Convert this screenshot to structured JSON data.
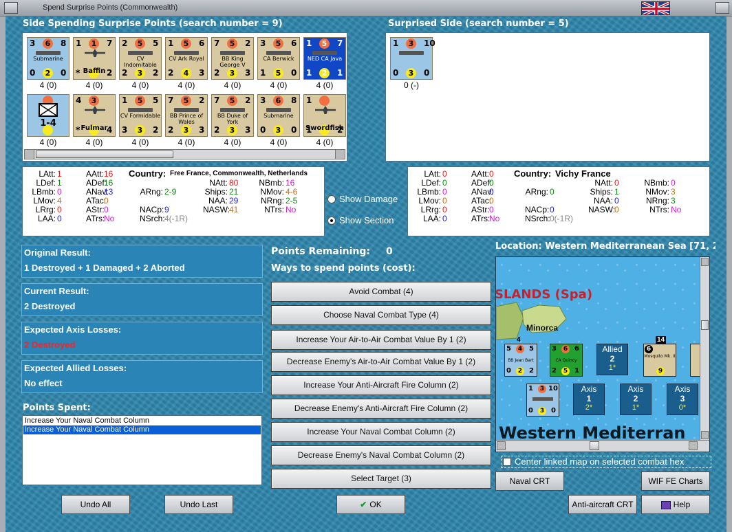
{
  "window": {
    "title": "Spend Surprise Points (Commonwealth)"
  },
  "headers": {
    "spending": "Side Spending Surprise Points (search number = 9)",
    "surprised": "Surprised Side (search number = 5)"
  },
  "spending_units": [
    {
      "name": "Submarine",
      "tl": "3",
      "tc": "6",
      "tr": "8",
      "bl": "0",
      "bc": "2",
      "br": "0",
      "count": "4 (0)",
      "kind": "ship",
      "style": "blue"
    },
    {
      "name": "Baffin",
      "tl": "1",
      "tc": "1",
      "tr": "7",
      "bl": "*",
      "bc": "",
      "br": "2",
      "count": "4 (0)",
      "kind": "plane",
      "style": "tan"
    },
    {
      "name": "CV Indomitable",
      "tl": "2",
      "tc": "5",
      "tr": "5",
      "bl": "2",
      "bc": "3",
      "br": "2",
      "count": "4 (0)",
      "kind": "ship",
      "style": "tan"
    },
    {
      "name": "CV Ark Royal",
      "tl": "1",
      "tc": "5",
      "tr": "6",
      "bl": "2",
      "bc": "4",
      "br": "3",
      "count": "4 (0)",
      "kind": "ship",
      "style": "tan"
    },
    {
      "name": "BB King George V",
      "tl": "7",
      "tc": "5",
      "tr": "2",
      "bl": "2",
      "bc": "3",
      "br": "3",
      "count": "4 (0)",
      "kind": "ship",
      "style": "tan"
    },
    {
      "name": "CA Berwick",
      "tl": "3",
      "tc": "5",
      "tr": "6",
      "bl": "1",
      "bc": "5",
      "br": "0",
      "count": "4 (0)",
      "kind": "ship",
      "style": "tan"
    },
    {
      "name": "NED CA Java",
      "tl": "1",
      "tc": "5",
      "tr": "7",
      "bl": "1",
      "bc": "2",
      "br": "1",
      "count": "4 (0)",
      "kind": "ship",
      "style": "dark"
    },
    {
      "name": "xx 1-4",
      "tl": "",
      "tc": "",
      "tr": "",
      "bl": "",
      "bc": "",
      "br": "",
      "count": "4 (0)",
      "kind": "div",
      "style": "blue"
    },
    {
      "name": "Fulmar",
      "tl": "4",
      "tc": "3",
      "tr": "",
      "bl": "*",
      "bc": "",
      "br": "4",
      "count": "4 (0)",
      "kind": "plane",
      "style": "tan"
    },
    {
      "name": "CV Formidable",
      "tl": "1",
      "tc": "5",
      "tr": "5",
      "bl": "3",
      "bc": "3",
      "br": "2",
      "count": "4 (0)",
      "kind": "ship",
      "style": "tan"
    },
    {
      "name": "BB Prince of Wales",
      "tl": "7",
      "tc": "5",
      "tr": "2",
      "bl": "2",
      "bc": "3",
      "br": "3",
      "count": "4 (0)",
      "kind": "ship",
      "style": "tan"
    },
    {
      "name": "BB Duke of York",
      "tl": "7",
      "tc": "5",
      "tr": "2",
      "bl": "2",
      "bc": "3",
      "br": "3",
      "count": "4 (0)",
      "kind": "ship",
      "style": "tan"
    },
    {
      "name": "Submarine",
      "tl": "3",
      "tc": "6",
      "tr": "8",
      "bl": "0",
      "bc": "3",
      "br": "0",
      "count": "4 (0)",
      "kind": "ship",
      "style": "tan"
    },
    {
      "name": "Swordfish",
      "tl": "1",
      "tc": "",
      "tr": "",
      "bl": "1",
      "bc": "",
      "br": "2",
      "count": "4 (0)",
      "kind": "plane",
      "style": "tan"
    }
  ],
  "surprised_units": [
    {
      "name": "",
      "tl": "1",
      "tc": "3",
      "tr": "10",
      "bl": "0",
      "bc": "3",
      "br": "0",
      "count": "0 (-)",
      "kind": "ship",
      "style": "blue"
    }
  ],
  "stats_left": {
    "c1": [
      [
        "LAtt:",
        "1"
      ],
      [
        "LDef:",
        "1"
      ],
      [
        "LBmb:",
        "0"
      ],
      [
        "LMov:",
        "4"
      ],
      [
        "LRrg:",
        "0"
      ],
      [
        "LAA:",
        "0"
      ]
    ],
    "c2": [
      [
        "AAtt:",
        "16"
      ],
      [
        "ADef:",
        "16"
      ],
      [
        "ANav:",
        "13"
      ],
      [
        "ATac:",
        "0"
      ],
      [
        "AStr:",
        "0"
      ],
      [
        "ATrs:",
        "No"
      ]
    ],
    "country_label": "Country:",
    "country": "Free France, Commonwealth, Netherlands",
    "c3": [
      [
        "",
        ""
      ],
      [
        "",
        ""
      ],
      [
        "ARng:",
        "2-9"
      ],
      [
        "",
        ""
      ],
      [
        "NACp:",
        "9"
      ],
      [
        "NSrch:",
        "4(-1R)"
      ]
    ],
    "c4": [
      [
        "NAtt:",
        "80"
      ],
      [
        "Ships:",
        "21"
      ],
      [
        "NAA:",
        "29"
      ],
      [
        "NASW:",
        "41"
      ]
    ],
    "c5": [
      [
        "NBmb:",
        "16"
      ],
      [
        "NMov:",
        "4-6"
      ],
      [
        "NRng:",
        "2-5"
      ],
      [
        "NTrs:",
        "No"
      ]
    ]
  },
  "stats_right": {
    "c1": [
      [
        "LAtt:",
        "0"
      ],
      [
        "LDef:",
        "0"
      ],
      [
        "LBmb:",
        "0"
      ],
      [
        "LMov:",
        "0"
      ],
      [
        "LRrg:",
        "0"
      ],
      [
        "LAA:",
        "0"
      ]
    ],
    "c2": [
      [
        "AAtt:",
        "0"
      ],
      [
        "ADef:",
        "0"
      ],
      [
        "ANav:",
        "0"
      ],
      [
        "ATac:",
        "0"
      ],
      [
        "AStr:",
        "0"
      ],
      [
        "ATrs:",
        "No"
      ]
    ],
    "country_label": "Country:",
    "country": "Vichy France",
    "c3": [
      [
        "",
        ""
      ],
      [
        "",
        ""
      ],
      [
        "ARng:",
        "0"
      ],
      [
        "",
        ""
      ],
      [
        "NACp:",
        "0"
      ],
      [
        "NSrch:",
        "0(-1R)"
      ]
    ],
    "c4": [
      [
        "NAtt:",
        "0"
      ],
      [
        "Ships:",
        "1"
      ],
      [
        "NAA:",
        "0"
      ],
      [
        "NASW:",
        "0"
      ]
    ],
    "c5": [
      [
        "NBmb:",
        "0"
      ],
      [
        "NMov:",
        "3"
      ],
      [
        "NRng:",
        "3"
      ],
      [
        "NTrs:",
        "No"
      ]
    ]
  },
  "radios": {
    "damage": "Show Damage",
    "section": "Show Section"
  },
  "results": {
    "original_label": "Original Result:",
    "original": "1 Destroyed + 1 Damaged + 2 Aborted",
    "current_label": "Current Result:",
    "current": "2 Destroyed",
    "axis_label": "Expected Axis Losses:",
    "axis": "2 Destroyed",
    "allied_label": "Expected Allied Losses:",
    "allied": "No effect",
    "spent_label": "Points Spent:"
  },
  "points_spent": [
    "Increase Your Naval Combat Column",
    "Increase Your Naval Combat Column"
  ],
  "points": {
    "remaining_label": "Points Remaining:",
    "remaining": "0",
    "ways": "Ways to spend points (cost):"
  },
  "options": [
    "Avoid Combat (4)",
    "Choose Naval Combat Type (4)",
    "Increase Your Air-to-Air Combat Value By 1 (2)",
    "Decrease Enemy's Air-to-Air Combat Value By 1 (2)",
    "Increase Your Anti-Aircraft Fire Column (2)",
    "Decrease Enemy's Anti-Aircraft Fire Column (2)",
    "Increase Your Naval Combat Column (2)",
    "Decrease Enemy's Naval Combat Column (2)",
    "Select Target (3)"
  ],
  "map": {
    "location": "Location: Western Mediterranean Sea [71, 2",
    "islands": "SLANDS (Spa)",
    "minorca": "Minorca",
    "sea": "Western Mediterran",
    "center_label": "Center linked map on selected combat hex",
    "stack1": "4",
    "stack2": "14",
    "counter_bb": {
      "name": "BB Jean Bart",
      "tl": "5",
      "tc": "4",
      "tr": "5",
      "bl": "0",
      "bc": "2",
      "br": "2"
    },
    "counter_ca": {
      "name": "CA Quincy",
      "tl": "3",
      "tc": "6",
      "tr": "6",
      "bl": "2",
      "bc": "5",
      "br": "1"
    },
    "counter_mos": {
      "name": "Mosquito Mk. II",
      "tl": "6",
      "bc": "9"
    },
    "counter_sub": {
      "tl": "1",
      "tc": "3",
      "tr": "10",
      "bl": "0",
      "bc": "3",
      "br": "0"
    },
    "allied": {
      "label": "Allied",
      "num": "2",
      "sub": "1*"
    },
    "axis1": {
      "label": "Axis",
      "num": "1",
      "sub": "2*"
    },
    "axis2": {
      "label": "Axis",
      "num": "2",
      "sub": "1*"
    },
    "axis3": {
      "label": "Axis",
      "num": "3",
      "sub": "0*"
    }
  },
  "buttons": {
    "naval_crt": "Naval CRT",
    "wif_charts": "WIF FE Charts",
    "aa_crt": "Anti-aircraft CRT",
    "help": "Help",
    "undo_all": "Undo All",
    "undo_last": "Undo Last",
    "ok": "OK"
  },
  "colors": {
    "blue_val": "#2222cc",
    "red_val": "#dd2222",
    "green_val": "#118811",
    "purple_val": "#cc22cc",
    "orange_val": "#c07020",
    "gray_val": "#888888",
    "axis_loss": "#ff2020"
  }
}
